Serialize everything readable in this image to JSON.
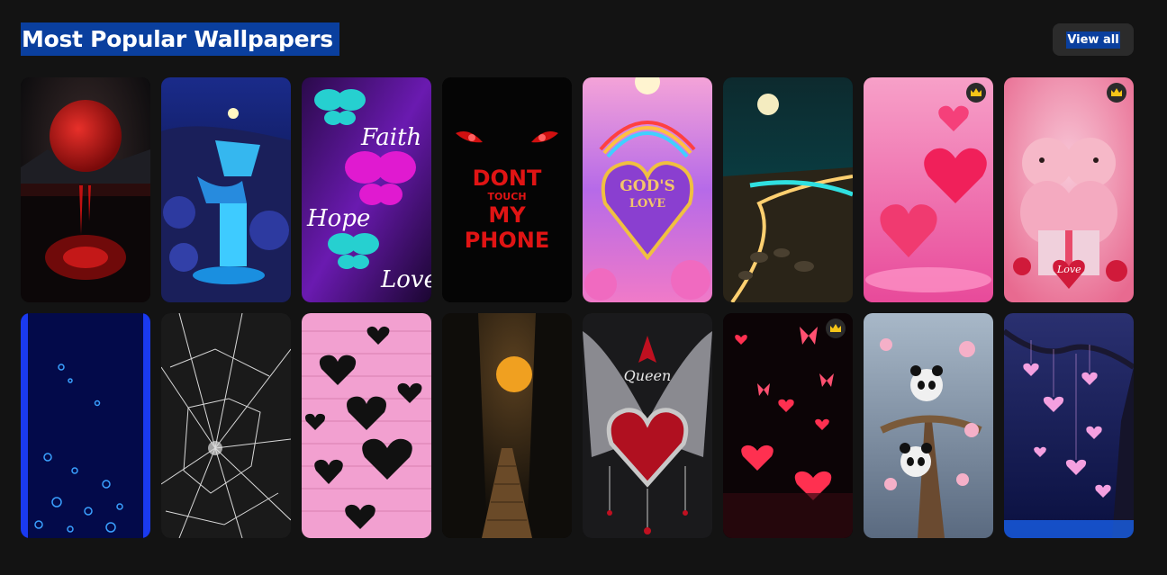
{
  "header": {
    "title": "Most Popular Wallpapers",
    "view_all_label": "View all"
  },
  "wallpapers": [
    {
      "name": "red-moon",
      "premium": false
    },
    {
      "name": "blue-waterfall",
      "premium": false
    },
    {
      "name": "butterfly-faith-hope-love",
      "premium": false,
      "texts": [
        "Faith",
        "Hope",
        "Love"
      ]
    },
    {
      "name": "dont-touch-my-phone",
      "premium": false,
      "texts": [
        "DONT",
        "TOUCH",
        "MY",
        "PHONE"
      ]
    },
    {
      "name": "gods-love-heart",
      "premium": false,
      "texts": [
        "GOD'S",
        "LOVE"
      ]
    },
    {
      "name": "moonlit-beach",
      "premium": false
    },
    {
      "name": "pink-hearts",
      "premium": true
    },
    {
      "name": "pink-puppies",
      "premium": true,
      "texts": [
        "Love"
      ]
    },
    {
      "name": "blue-bubbles",
      "premium": false
    },
    {
      "name": "cracked-screen",
      "premium": false
    },
    {
      "name": "black-hearts-pink-bricks",
      "premium": false
    },
    {
      "name": "forest-bridge-moon",
      "premium": false
    },
    {
      "name": "queen-winged-heart",
      "premium": false,
      "texts": [
        "Queen"
      ]
    },
    {
      "name": "glowing-hearts-butterflies",
      "premium": true
    },
    {
      "name": "pandas-in-tree",
      "premium": false
    },
    {
      "name": "heart-lanterns-tree",
      "premium": false
    }
  ],
  "colors": {
    "background": "#131313",
    "selection": "#0a3f9e",
    "button": "#2b2b2b",
    "crown": "#f5c518"
  },
  "icons": {
    "premium": "crown-icon"
  }
}
